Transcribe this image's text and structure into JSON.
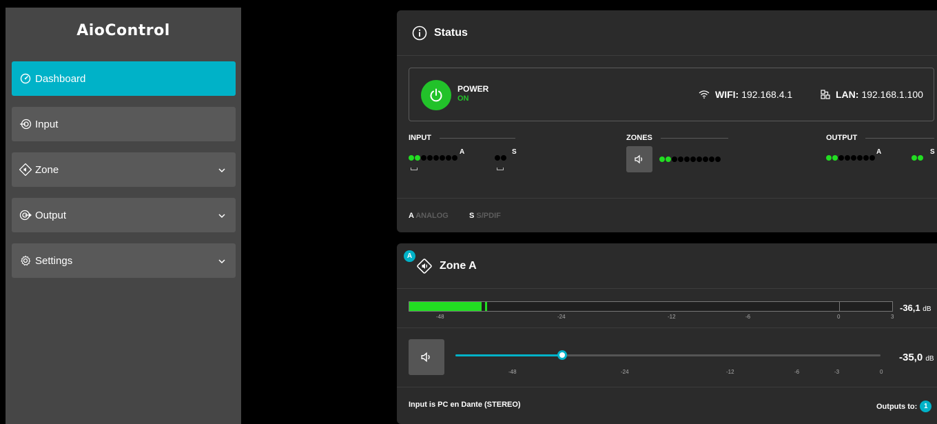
{
  "app": {
    "title": "AioControl"
  },
  "sidebar": {
    "items": [
      {
        "label": "Dashboard",
        "icon": "gauge-icon",
        "active": true
      },
      {
        "label": "Input",
        "icon": "input-icon"
      },
      {
        "label": "Zone",
        "icon": "zone-speaker-icon",
        "expandable": true
      },
      {
        "label": "Output",
        "icon": "output-icon",
        "expandable": true
      },
      {
        "label": "Settings",
        "icon": "gear-icon",
        "expandable": true
      }
    ]
  },
  "status": {
    "title": "Status",
    "power": {
      "label": "POWER",
      "state": "ON"
    },
    "wifi": {
      "label": "WIFI:",
      "value": "192.168.4.1"
    },
    "lan": {
      "label": "LAN:",
      "value": "192.168.1.100"
    },
    "groups": {
      "input": {
        "label": "INPUT",
        "a": "A",
        "s": "S"
      },
      "zones": {
        "label": "ZONES"
      },
      "output": {
        "label": "OUTPUT",
        "a": "A",
        "s": "S"
      }
    },
    "legend": {
      "a_key": "A",
      "a_text": "ANALOG",
      "s_key": "S",
      "s_text": "S/PDIF"
    }
  },
  "zone": {
    "badge": "A",
    "title": "Zone A",
    "meter": {
      "scale": [
        "-48",
        "-24",
        "-12",
        "-6",
        "0",
        "3"
      ],
      "level_db": "-36,1",
      "unit": "dB"
    },
    "volume": {
      "scale": [
        "-48",
        "-24",
        "-12",
        "-6",
        "-3",
        "0"
      ],
      "value_db": "-35,0",
      "unit": "dB"
    },
    "input_text": "Input is PC en Dante (STEREO)",
    "outputs_label": "Outputs to:",
    "outputs_count": "1"
  },
  "colors": {
    "accent": "#00b2c8",
    "power_on": "#22c22a",
    "signal": "#22dd22"
  }
}
